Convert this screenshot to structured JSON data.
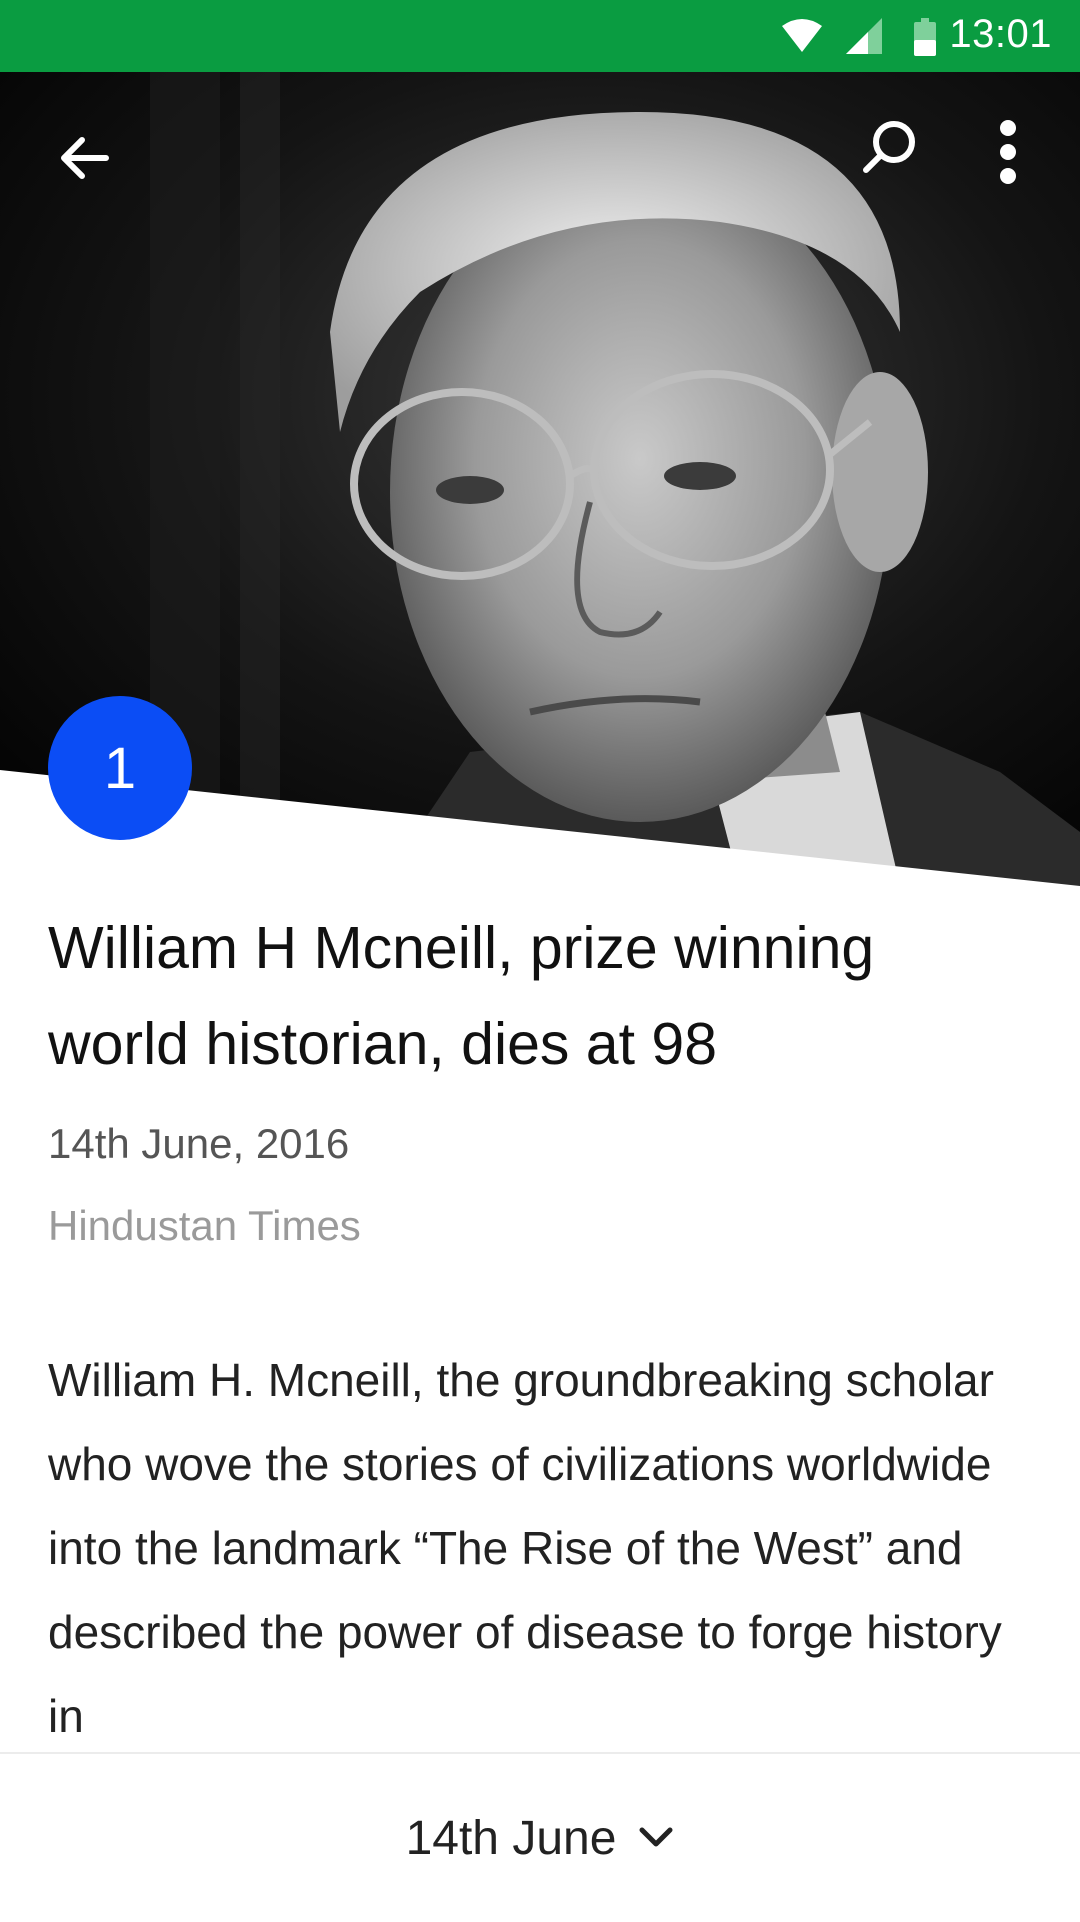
{
  "status_bar": {
    "time": "13:01",
    "icons": [
      "wifi-icon",
      "signal-icon",
      "battery-icon"
    ],
    "color": "#0a9c41"
  },
  "toolbar": {
    "icons": [
      "back-arrow-icon",
      "search-icon",
      "more-vert-icon"
    ]
  },
  "article": {
    "rank": "1",
    "rank_color": "#0b4df5",
    "headline": "William H Mcneill, prize winning world historian, dies at 98",
    "date": "14th June, 2016",
    "source": "Hindustan Times",
    "body": "William H. Mcneill, the groundbreaking scholar who wove the stories of civilizations worldwide into the landmark “The Rise of the West” and described the power of disease to forge history in"
  },
  "bottom_bar": {
    "date_label": "14th June",
    "icon": "chevron-down-icon"
  }
}
